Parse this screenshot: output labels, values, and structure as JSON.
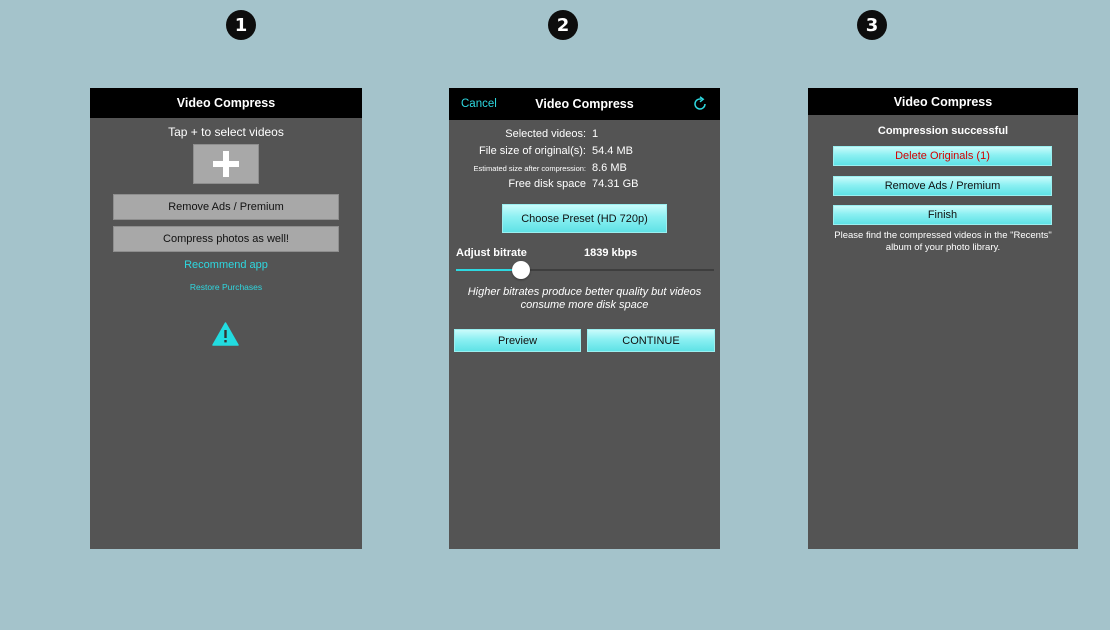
{
  "steps": [
    "1",
    "2",
    "3"
  ],
  "colors": {
    "background": "#a4c3cb",
    "panel": "#545454",
    "topbar": "#000000",
    "accent": "#2ed8e0",
    "danger": "#d40000"
  },
  "screen1": {
    "title": "Video Compress",
    "instruction": "Tap + to select videos",
    "add_icon": "plus-icon",
    "remove_ads_label": "Remove Ads / Premium",
    "compress_photos_label": "Compress photos as well!",
    "recommend_link": "Recommend app",
    "restore_link": "Restore Purchases",
    "warning_icon": "warning-icon"
  },
  "screen2": {
    "cancel_label": "Cancel",
    "title": "Video Compress",
    "refresh_icon": "refresh-icon",
    "info": [
      {
        "label": "Selected videos:",
        "value": "1"
      },
      {
        "label": "File size of original(s):",
        "value": "54.4 MB"
      },
      {
        "label": "Estimated size after compression:",
        "value": "8.6 MB"
      },
      {
        "label": "Free disk space",
        "value": "74.31 GB"
      }
    ],
    "preset_label": "Choose Preset (HD 720p)",
    "bitrate_label": "Adjust bitrate",
    "bitrate_value": "1839 kbps",
    "slider_fraction": 0.25,
    "hint": "Higher bitrates produce better quality but videos consume more disk space",
    "preview_label": "Preview",
    "continue_label": "CONTINUE"
  },
  "screen3": {
    "title": "Video Compress",
    "status": "Compression successful",
    "delete_label": "Delete Originals (1)",
    "remove_ads_label": "Remove Ads / Premium",
    "finish_label": "Finish",
    "note": "Please find the compressed videos in the \"Recents\" album of your photo library."
  }
}
